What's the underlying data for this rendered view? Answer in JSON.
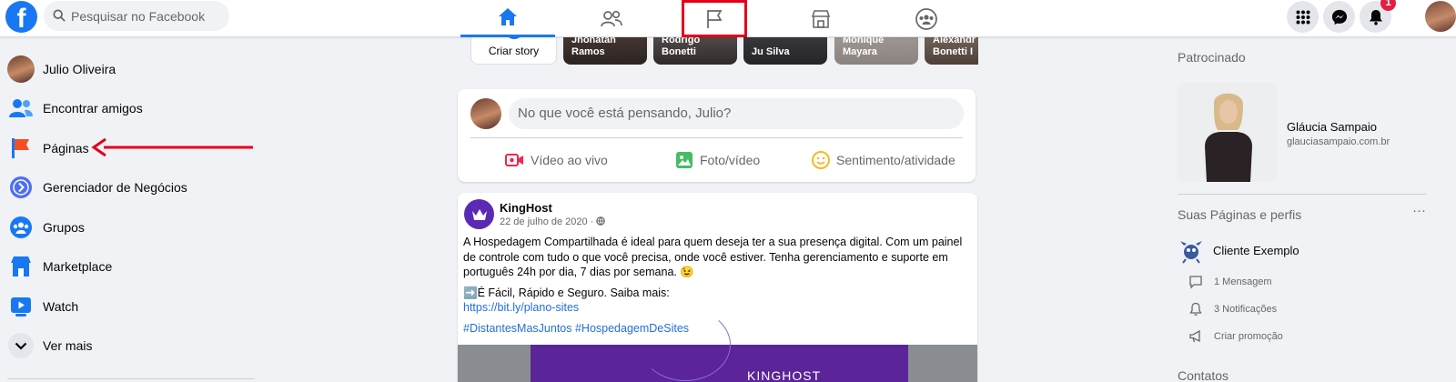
{
  "header": {
    "logo": "f",
    "search_placeholder": "Pesquisar no Facebook",
    "nav_tabs": [
      {
        "name": "home"
      },
      {
        "name": "friends"
      },
      {
        "name": "pages"
      },
      {
        "name": "marketplace"
      },
      {
        "name": "groups"
      }
    ],
    "notification_count": "1"
  },
  "sidebar": {
    "items": [
      {
        "label": "Julio Oliveira",
        "icon": "user-avatar"
      },
      {
        "label": "Encontrar amigos",
        "icon": "friends-icon"
      },
      {
        "label": "Páginas",
        "icon": "flag-icon"
      },
      {
        "label": "Gerenciador de Negócios",
        "icon": "business-manager-icon"
      },
      {
        "label": "Grupos",
        "icon": "groups-icon"
      },
      {
        "label": "Marketplace",
        "icon": "marketplace-icon"
      },
      {
        "label": "Watch",
        "icon": "watch-icon"
      },
      {
        "label": "Ver mais",
        "icon": "chevron-down-icon"
      }
    ]
  },
  "stories": {
    "create_label": "Criar story",
    "items": [
      {
        "name_line1": "Jhonatan",
        "name_line2": "Ramos"
      },
      {
        "name_line1": "Rodrigo",
        "name_line2": "Bonetti"
      },
      {
        "name_line1": "",
        "name_line2": "Ju Silva"
      },
      {
        "name_line1": "Monique",
        "name_line2": "Mayara"
      },
      {
        "name_line1": "Alexandr",
        "name_line2": "Bonetti I"
      }
    ]
  },
  "composer": {
    "placeholder": "No que você está pensando, Julio?",
    "actions": {
      "live": "Vídeo ao vivo",
      "photo": "Foto/vídeo",
      "feeling": "Sentimento/atividade"
    }
  },
  "post": {
    "author": "KingHost",
    "date": "22 de julho de 2020 · ",
    "paragraph1": "A Hospedagem Compartilhada é ideal para quem deseja ter a sua presença digital. Com um painel de controle com tudo o que você precisa, onde você estiver. Tenha gerenciamento e suporte em português 24h por dia, 7 dias por semana. 😉",
    "paragraph2": "➡️É Fácil, Rápido e Seguro. Saiba mais:",
    "link": "https://bit.ly/plano-sites",
    "hashtags": "#DistantesMasJuntos #HospedagemDeSites",
    "media_text": "KINGHOST"
  },
  "right": {
    "sponsored_title": "Patrocinado",
    "ad_name": "Gláucia Sampaio",
    "ad_url": "glauciasampaio.com.br",
    "pages_title": "Suas Páginas e perfis",
    "more": "···",
    "page_name": "Cliente Exemplo",
    "messages": "1 Mensagem",
    "notifications": "3 Notificações",
    "promote": "Criar promoção",
    "contacts_title": "Contatos"
  },
  "colors": {
    "brand": "#1877f2",
    "annotation": "#e3001b",
    "badge": "#e41e3f"
  }
}
